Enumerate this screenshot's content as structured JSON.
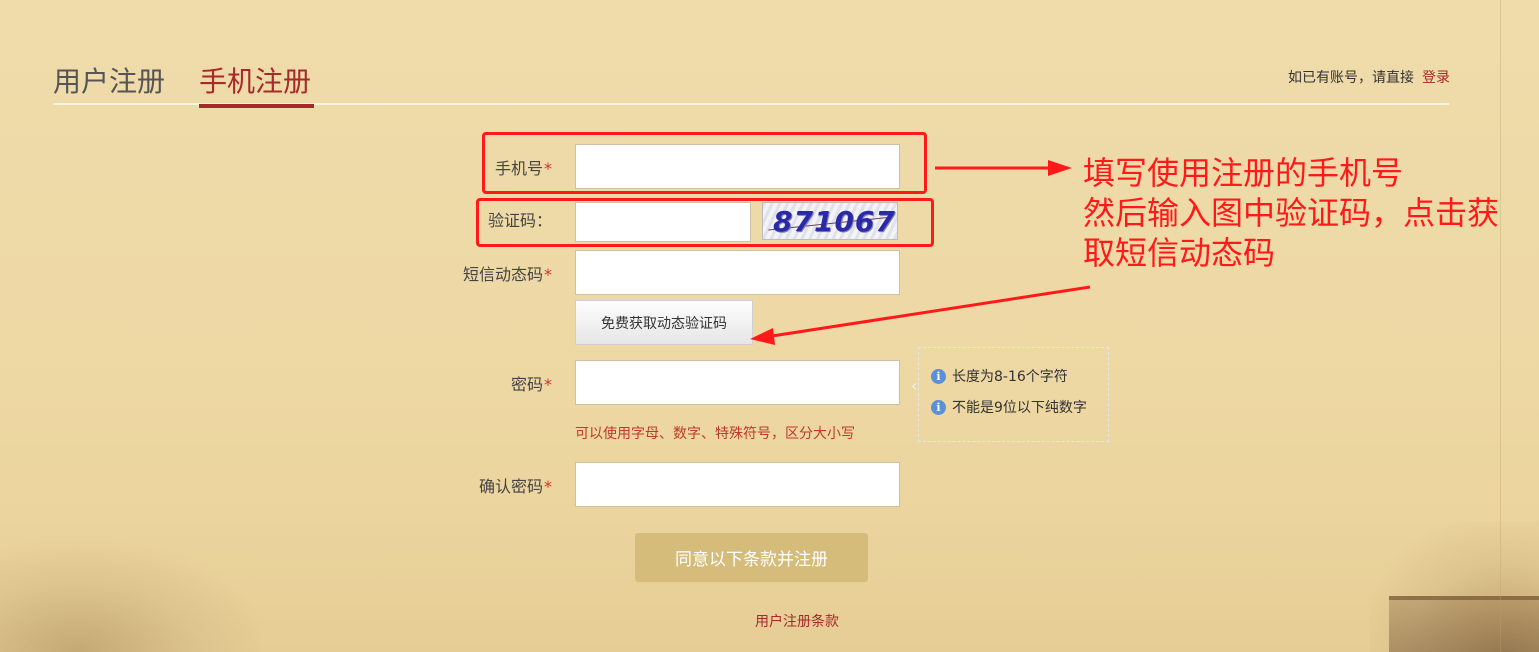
{
  "tabs": {
    "user_register": "用户注册",
    "phone_register": "手机注册"
  },
  "login_hint": {
    "text": "如已有账号，请直接",
    "link": "登录"
  },
  "form": {
    "phone_label": "手机号",
    "captcha_label": "验证码：",
    "captcha_value": "871067",
    "sms_code_label": "短信动态码",
    "sms_button": "免费获取动态验证码",
    "password_label": "密码",
    "password_hint": "可以使用字母、数字、特殊符号，区分大小写",
    "confirm_label": "确认密码",
    "required_mark": "*",
    "submit": "同意以下条款并注册",
    "terms_link": "用户注册条款"
  },
  "password_tips": [
    "长度为8-16个字符",
    "不能是9位以下纯数字"
  ],
  "annotation": {
    "lines": [
      "填写使用注册的手机号",
      "然后输入图中验证码，点击获",
      "取短信动态码"
    ]
  },
  "colors": {
    "accent": "#a8292a",
    "annotation": "#ff1a1a",
    "submit_bg": "#d6bc7a",
    "info_icon": "#5b8fd6"
  },
  "icons": [
    "info-icon",
    "arrow-icon"
  ]
}
